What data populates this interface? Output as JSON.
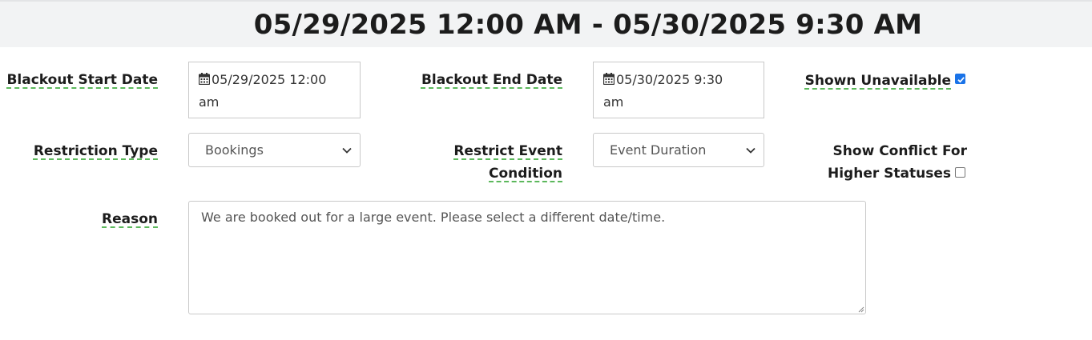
{
  "header": {
    "title": "05/29/2025 12:00 AM - 05/30/2025 9:30 AM"
  },
  "form": {
    "start_date": {
      "label": "Blackout Start Date",
      "value_line1": "05/29/2025 12:00",
      "value_line2": "am",
      "icon": "calendar-icon"
    },
    "end_date": {
      "label": "Blackout End Date",
      "value_line1": "05/30/2025 9:30",
      "value_line2": "am",
      "icon": "calendar-icon"
    },
    "shown_unavailable": {
      "label": "Shown Unavailable",
      "checked": true
    },
    "restriction_type": {
      "label": "Restriction Type",
      "selected": "Bookings"
    },
    "restrict_condition": {
      "label_line1": "Restrict Event",
      "label_line2": "Condition",
      "selected": "Event Duration"
    },
    "show_conflict": {
      "label_line1": "Show Conflict For",
      "label_line2": "Higher Statuses",
      "checked": false
    },
    "reason": {
      "label": "Reason",
      "value": "We are booked out for a large event. Please select a different date/time."
    }
  },
  "colors": {
    "accent_underline": "#5cb85c",
    "checkbox_checked": "#1a73e8",
    "header_bg": "#f2f3f4"
  }
}
